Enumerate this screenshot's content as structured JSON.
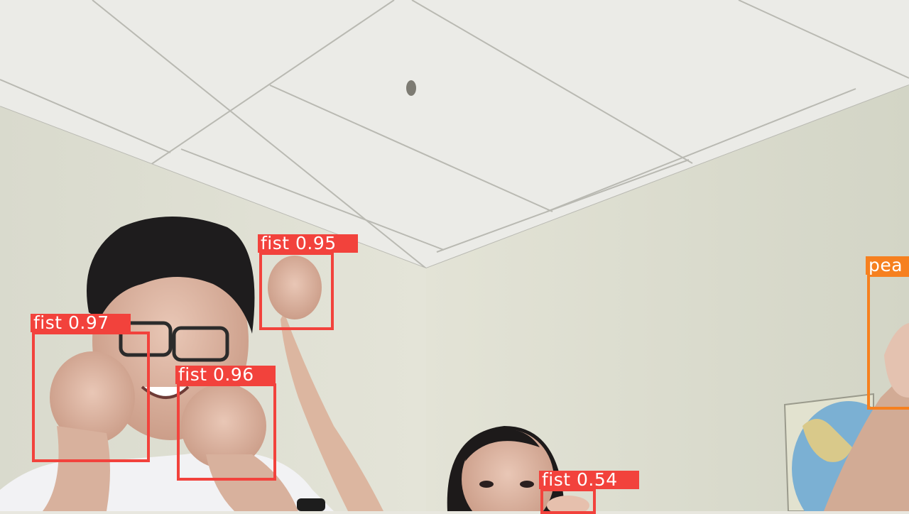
{
  "detections": [
    {
      "label": "fist",
      "score": "0.95",
      "text": "fist 0.95",
      "color": "#f2423c"
    },
    {
      "label": "fist",
      "score": "0.97",
      "text": "fist 0.97",
      "color": "#f2423c"
    },
    {
      "label": "fist",
      "score": "0.96",
      "text": "fist 0.96",
      "color": "#f2423c"
    },
    {
      "label": "fist",
      "score": "0.54",
      "text": "fist 0.54",
      "color": "#f2423c"
    },
    {
      "label": "peace",
      "text": "pea",
      "color": "#f6801f"
    }
  ],
  "colors": {
    "fist": "#f2423c",
    "peace": "#f6801f"
  }
}
